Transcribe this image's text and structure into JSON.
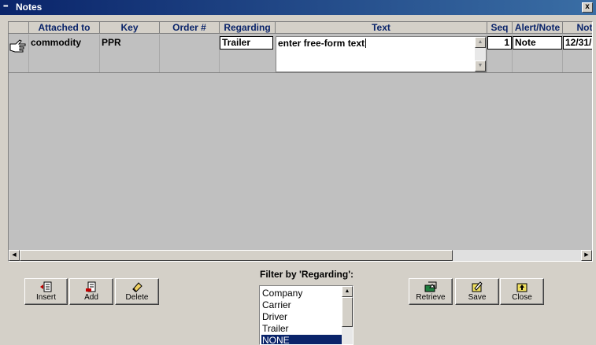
{
  "window": {
    "title": "Notes",
    "icon": "notes-app-icon",
    "close_label": "x"
  },
  "grid": {
    "columns": [
      "Attached to",
      "Key",
      "Order #",
      "Regarding",
      "Text",
      "Seq",
      "Alert/Note",
      "Not"
    ],
    "row": {
      "attached_to": "commodity",
      "key": "PPR",
      "order_no": "",
      "regarding": "Trailer",
      "text": "enter free-form text",
      "seq": "1",
      "alert_note": "Note",
      "date": "12/31/"
    }
  },
  "buttons": {
    "insert": {
      "label": "Insert",
      "icon": "insert-row-icon"
    },
    "add": {
      "label": "Add",
      "icon": "add-row-icon"
    },
    "delete": {
      "label": "Delete",
      "icon": "eraser-icon"
    },
    "retrieve": {
      "label": "Retrieve",
      "icon": "retrieve-icon"
    },
    "save": {
      "label": "Save",
      "icon": "save-icon"
    },
    "close": {
      "label": "Close",
      "icon": "close-folder-icon"
    }
  },
  "filter": {
    "label": "Filter by 'Regarding':",
    "options": [
      "Company",
      "Carrier",
      "Driver",
      "Trailer",
      "NONE"
    ],
    "selected": "NONE"
  },
  "colors": {
    "title_bar": "#0a246a",
    "header_text": "#0a246a",
    "selection": "#0a246a",
    "window_bg": "#d4d0c8"
  }
}
